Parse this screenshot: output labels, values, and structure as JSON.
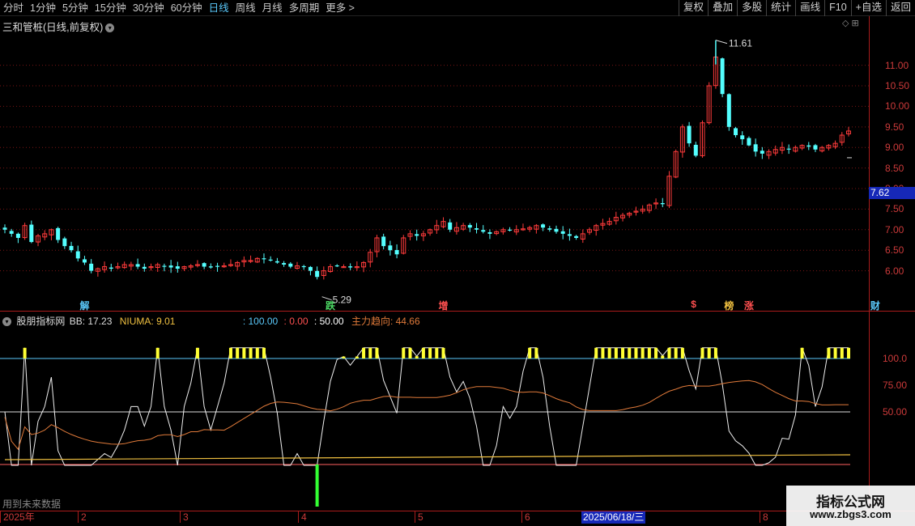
{
  "toolbar": {
    "periods": [
      "分时",
      "1分钟",
      "5分钟",
      "15分钟",
      "30分钟",
      "60分钟",
      "日线",
      "周线",
      "月线",
      "多周期",
      "更多 >"
    ],
    "active_period": "日线",
    "actions": [
      "复权",
      "叠加",
      "多股",
      "统计",
      "画线",
      "F10",
      "+自选",
      "返回"
    ]
  },
  "stock": {
    "title": "三和管桩(日线,前复权)",
    "current_price": "7.62",
    "high_label": "11.61",
    "low_label": "5.29"
  },
  "price_axis": [
    "11.00",
    "10.50",
    "10.00",
    "9.50",
    "9.00",
    "8.50",
    "8.00",
    "7.50",
    "7.00",
    "6.50",
    "6.00"
  ],
  "signals": [
    {
      "text": "解",
      "color": "#5ac8fa"
    },
    {
      "text": "跌",
      "color": "#4cd964"
    },
    {
      "text": "增",
      "color": "#ff5050"
    },
    {
      "text": "$",
      "color": "#ff5050"
    },
    {
      "text": "榜",
      "color": "#f0c040"
    },
    {
      "text": "涨",
      "color": "#ff5050"
    },
    {
      "text": "财",
      "color": "#5ac8fa"
    }
  ],
  "indicator": {
    "name": "股朋指标网",
    "bb": "BB: 17.23",
    "niuma": "NIUMA: 9.01",
    "l100": ": 100.00",
    "l0": ": 0.00",
    "l50": ": 50.00",
    "trend": "主力趋向: 44.66",
    "axis": [
      "100.0",
      "75.00",
      "50.00"
    ]
  },
  "date_axis": [
    "2025年",
    "2",
    "3",
    "4",
    "5",
    "6",
    "2025/06/18/三",
    "8"
  ],
  "footnote": "用到未来数据",
  "watermark": {
    "line1": "指标公式网",
    "line2": "www.zbgs3.com"
  },
  "colors": {
    "up": "#ff3b3b",
    "down": "#54ffff",
    "grid": "#aa1c1c",
    "accent": "#1628b8"
  },
  "chart_data": {
    "type": "candlestick",
    "title": "三和管桩(日线,前复权)",
    "ylim": [
      5.5,
      11.8
    ],
    "closes": [
      7.0,
      6.9,
      6.8,
      7.1,
      6.7,
      6.85,
      6.9,
      7.0,
      6.75,
      6.6,
      6.5,
      6.3,
      6.2,
      6.0,
      6.05,
      6.1,
      6.05,
      6.1,
      6.15,
      6.15,
      6.1,
      6.05,
      6.1,
      6.15,
      6.1,
      6.08,
      6.05,
      6.1,
      6.12,
      6.15,
      6.1,
      6.08,
      6.1,
      6.12,
      6.15,
      6.2,
      6.25,
      6.25,
      6.3,
      6.3,
      6.25,
      6.2,
      6.15,
      6.1,
      6.12,
      6.1,
      6.0,
      5.85,
      6.0,
      6.1,
      6.12,
      6.1,
      6.08,
      6.1,
      6.2,
      6.45,
      6.8,
      6.6,
      6.5,
      6.4,
      6.8,
      6.9,
      6.85,
      6.9,
      7.0,
      7.1,
      7.2,
      7.0,
      7.05,
      7.1,
      7.05,
      7.0,
      6.95,
      6.9,
      6.95,
      7.0,
      6.98,
      7.0,
      7.02,
      7.05,
      7.1,
      7.05,
      7.0,
      6.95,
      6.9,
      6.85,
      6.8,
      6.9,
      7.0,
      7.1,
      7.15,
      7.2,
      7.3,
      7.35,
      7.4,
      7.45,
      7.5,
      7.6,
      7.65,
      7.62,
      8.3,
      8.9,
      9.5,
      9.1,
      8.8,
      9.6,
      10.5,
      11.2,
      10.3,
      9.5,
      9.3,
      9.2,
      9.05,
      8.9,
      8.85,
      8.9,
      8.95,
      9.0,
      8.95,
      9.0,
      9.05,
      9.02,
      8.95,
      9.0,
      9.05,
      9.1,
      9.3,
      9.4
    ]
  }
}
